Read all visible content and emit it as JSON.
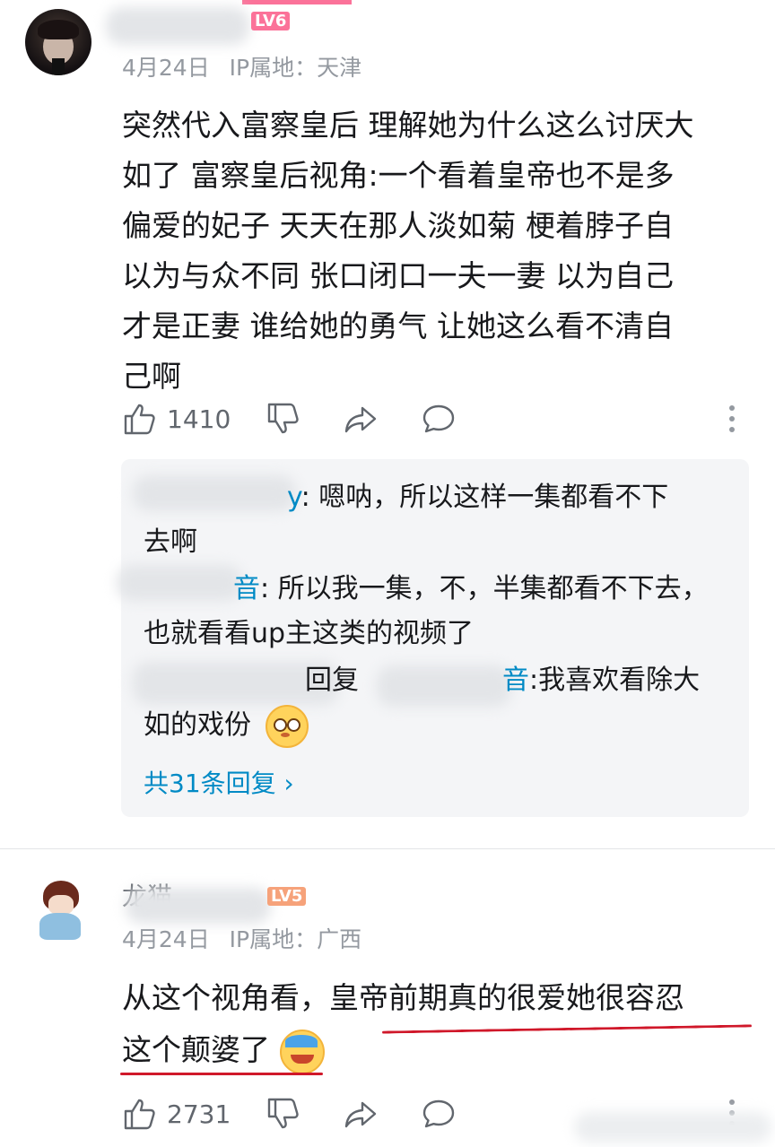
{
  "comments": [
    {
      "level": "LV6",
      "date": "4月24日",
      "ip_label": "IP属地：天津",
      "text_lines": [
        "突然代入富察皇后 理解她为什么这么讨厌大",
        "如了 富察皇后视角:一个看着皇帝也不是多",
        "偏爱的妃子 天天在那人淡如菊 梗着脖子自",
        "以为与众不同 张口闭口一夫一妻 以为自己",
        "才是正妻 谁给她的勇气 让她这么看不清自",
        "己啊"
      ],
      "like_count": "1410",
      "replies": [
        {
          "name_tail": "y",
          "text": ": 嗯呐，所以这样一集都看不下",
          "text2": "去啊"
        },
        {
          "name_tail": "音",
          "text": ": 所以我一集，不，半集都看不下去，",
          "text2": "也就看看up主这类的视频了"
        },
        {
          "reply_word": "回复",
          "mention_tail": "音",
          "text": ":我喜欢看除大",
          "text2": "如的戏份"
        }
      ],
      "more_replies": "共31条回复 ›"
    },
    {
      "level": "LV5",
      "name_visible": "龙猫",
      "date": "4月24日",
      "ip_label": "IP属地：广西",
      "text_lines": [
        "从这个视角看，皇帝前期真的很爱她很容忍",
        "这个颠婆了"
      ],
      "like_count": "2731"
    }
  ],
  "icons": {
    "like": "thumbs-up-icon",
    "dislike": "thumbs-down-icon",
    "share": "share-icon",
    "reply": "comment-icon",
    "more": "more-dots-icon"
  },
  "colors": {
    "accent_blue": "#008ac5",
    "underline_red": "#d0182a",
    "level_pink": "#fb7299"
  }
}
